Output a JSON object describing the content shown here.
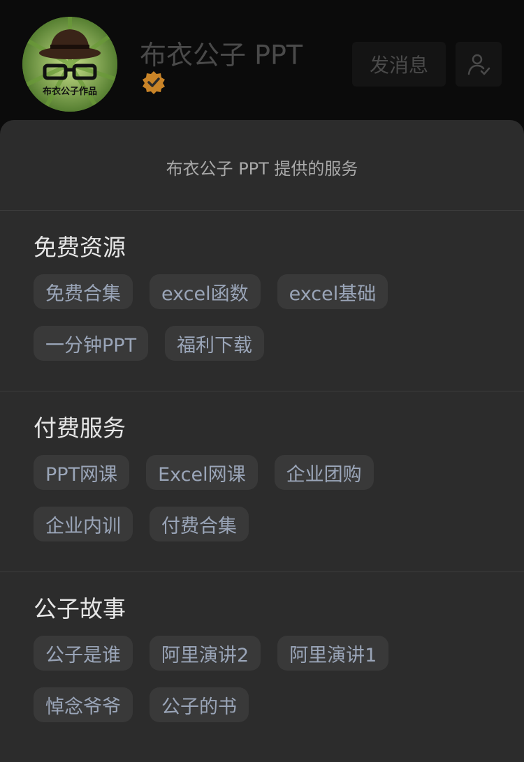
{
  "header": {
    "account_name": "布衣公子 PPT",
    "avatar_text": "布衣公子作品",
    "message_button": "发消息",
    "follow_icon": "user-check-icon",
    "verified_icon": "verified-badge-icon"
  },
  "sheet": {
    "title": "布衣公子 PPT 提供的服务",
    "sections": [
      {
        "title": "免费资源",
        "chips": [
          "免费合集",
          "excel函数",
          "excel基础",
          "一分钟PPT",
          "福利下载"
        ]
      },
      {
        "title": "付费服务",
        "chips": [
          "PPT网课",
          "Excel网课",
          "企业团购",
          "企业内训",
          "付费合集"
        ]
      },
      {
        "title": "公子故事",
        "chips": [
          "公子是谁",
          "阿里演讲2",
          "阿里演讲1",
          "悼念爷爷",
          "公子的书"
        ]
      }
    ]
  },
  "colors": {
    "background": "#000000",
    "sheet": "#2c2c2c",
    "chip_bg": "#393939",
    "chip_text": "#9aa5b8",
    "verified": "#d08a2a"
  }
}
